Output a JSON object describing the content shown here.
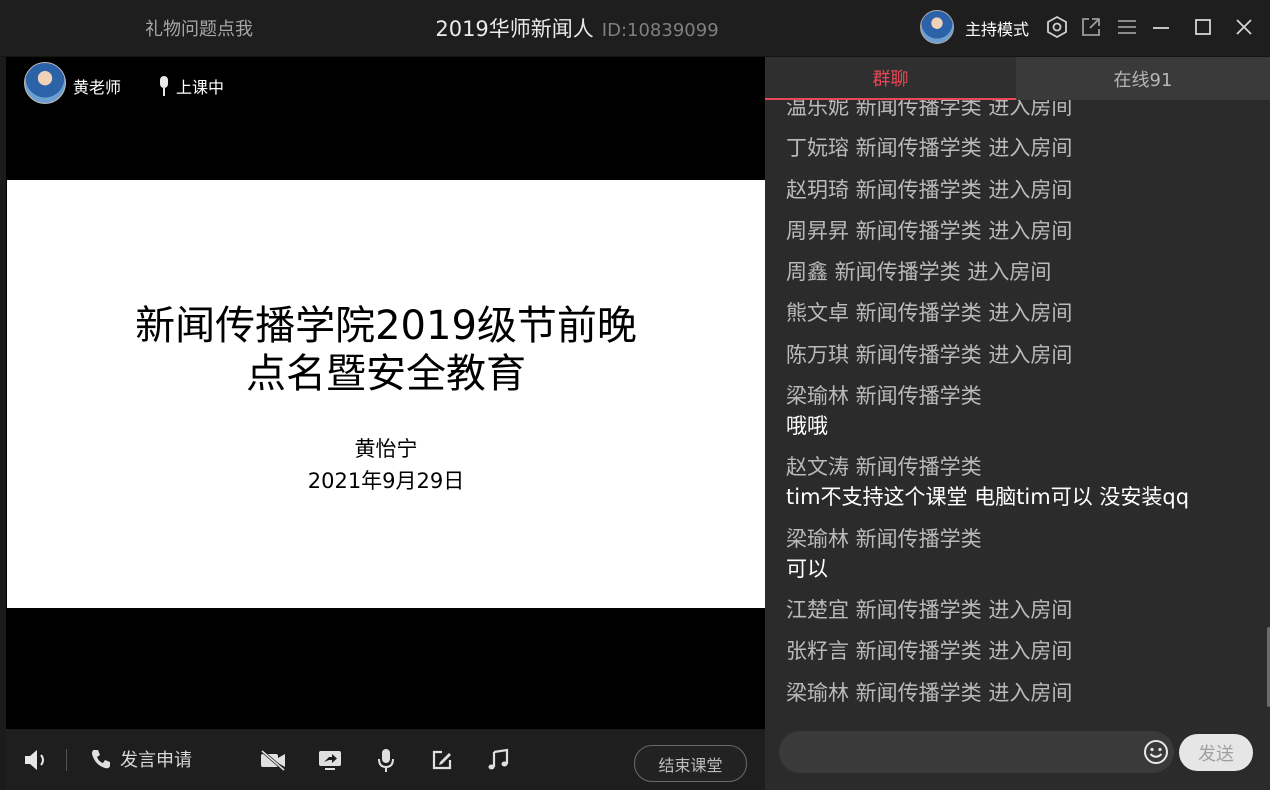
{
  "titlebar": {
    "gift_link": "礼物问题点我",
    "room_name": "2019华师新闻人",
    "room_id": "ID:10839099",
    "host_mode_label": "主持模式"
  },
  "stage": {
    "teacher_name": "黄老师",
    "status_label": "上课中",
    "slide": {
      "title_line1": "新闻传播学院2019级节前晚",
      "title_line2": "点名暨安全教育",
      "author": "黄怡宁",
      "date": "2021年9月29日"
    }
  },
  "toolbar": {
    "speak_request_label": "发言申请",
    "end_class_label": "结束课堂"
  },
  "chat": {
    "tabs": {
      "group": "群聊",
      "online": "在线91"
    },
    "messages": [
      {
        "text": "温乐妮 新闻传播学类 进入房间"
      },
      {
        "text": "丁妧瑢 新闻传播学类 进入房间"
      },
      {
        "text": "赵玥琦 新闻传播学类 进入房间"
      },
      {
        "text": "周昇昇 新闻传播学类 进入房间"
      },
      {
        "text": "周鑫 新闻传播学类 进入房间"
      },
      {
        "text": "熊文卓 新闻传播学类 进入房间"
      },
      {
        "text": "陈万琪 新闻传播学类 进入房间"
      },
      {
        "header": "梁瑜林 新闻传播学类",
        "content": "哦哦"
      },
      {
        "header": "赵文涛 新闻传播学类",
        "content": "tim不支持这个课堂 电脑tim可以 没安装qq"
      },
      {
        "header": "梁瑜林 新闻传播学类",
        "content": "可以"
      },
      {
        "text": "江楚宜 新闻传播学类 进入房间"
      },
      {
        "text": "张籽言 新闻传播学类 进入房间"
      },
      {
        "text": "梁瑜林 新闻传播学类 进入房间"
      }
    ],
    "input_value": "",
    "send_label": "发送"
  },
  "colors": {
    "accent": "#e84855",
    "panel": "#2b2b2b",
    "titlebar": "#1e1e1e"
  }
}
